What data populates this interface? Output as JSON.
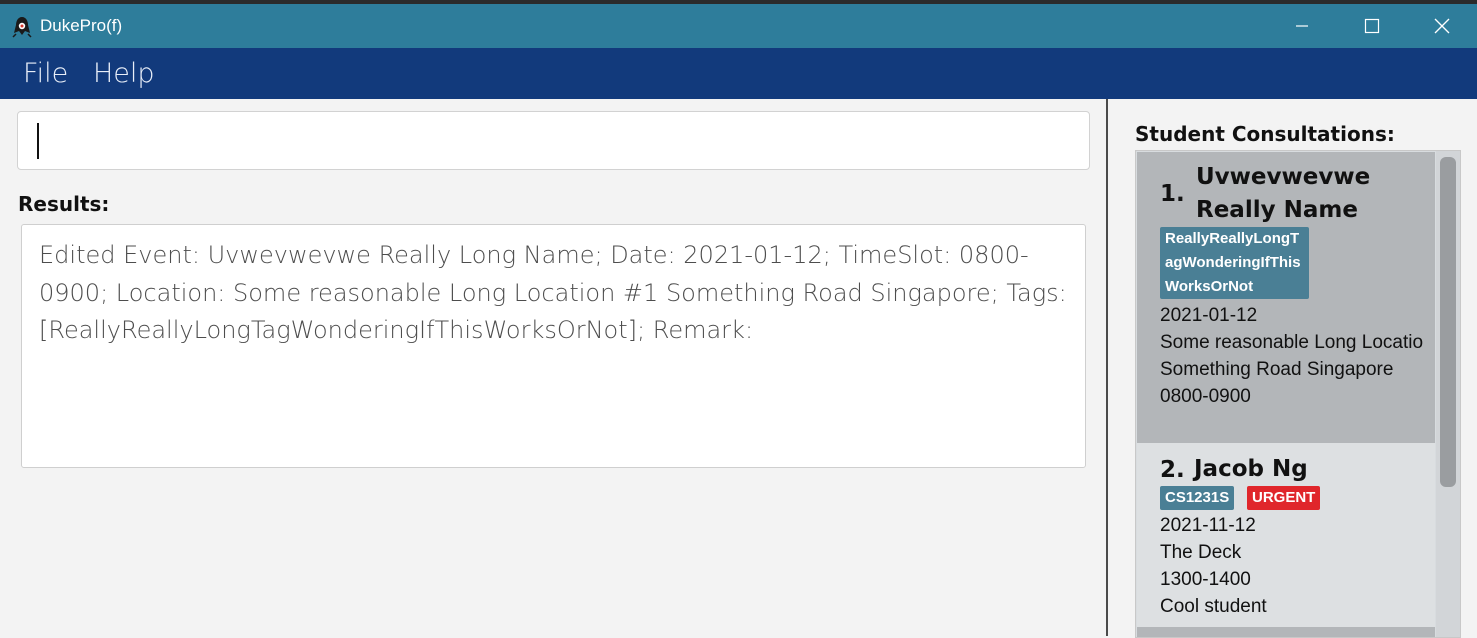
{
  "window": {
    "title": "DukePro(f)",
    "app_icon": "duke-icon",
    "controls": {
      "minimize": "minimize-icon",
      "maximize": "maximize-icon",
      "close": "close-icon"
    },
    "titlebar_color": "#2e7d9b"
  },
  "menu": {
    "file_label": "File",
    "help_label": "Help",
    "color": "#123a7c"
  },
  "command": {
    "value": "",
    "placeholder": ""
  },
  "results": {
    "label": "Results:",
    "text": "Edited Event: Uvwevwevwe Really Long Name; Date: 2021-01-12; TimeSlot: 0800-0900; Location: Some reasonable Long Location #1 Something Road Singapore; Tags: [ReallyReallyLongTagWonderingIfThisWorksOrNot]; Remark:"
  },
  "consultations": {
    "label": "Student Consultations:",
    "items": [
      {
        "index": "1.",
        "name": "Uvwevwevwe Really Name",
        "tags": [
          {
            "text": "ReallyReallyLongTagWonderingIfThisWorksOrNot",
            "color": "#4a7f95"
          }
        ],
        "date": "2021-01-12",
        "location_line1": "Some reasonable Long Locatio",
        "location_line2": "Something Road Singapore",
        "time": "0800-0900"
      },
      {
        "index": "2.",
        "name": "Jacob Ng",
        "tags": [
          {
            "text": "CS1231S",
            "color": "#4a7f95"
          },
          {
            "text": "URGENT",
            "color": "#e0262b"
          }
        ],
        "date": "2021-11-12",
        "location": "The Deck",
        "time": "1300-1400",
        "remark": "Cool student"
      }
    ]
  }
}
